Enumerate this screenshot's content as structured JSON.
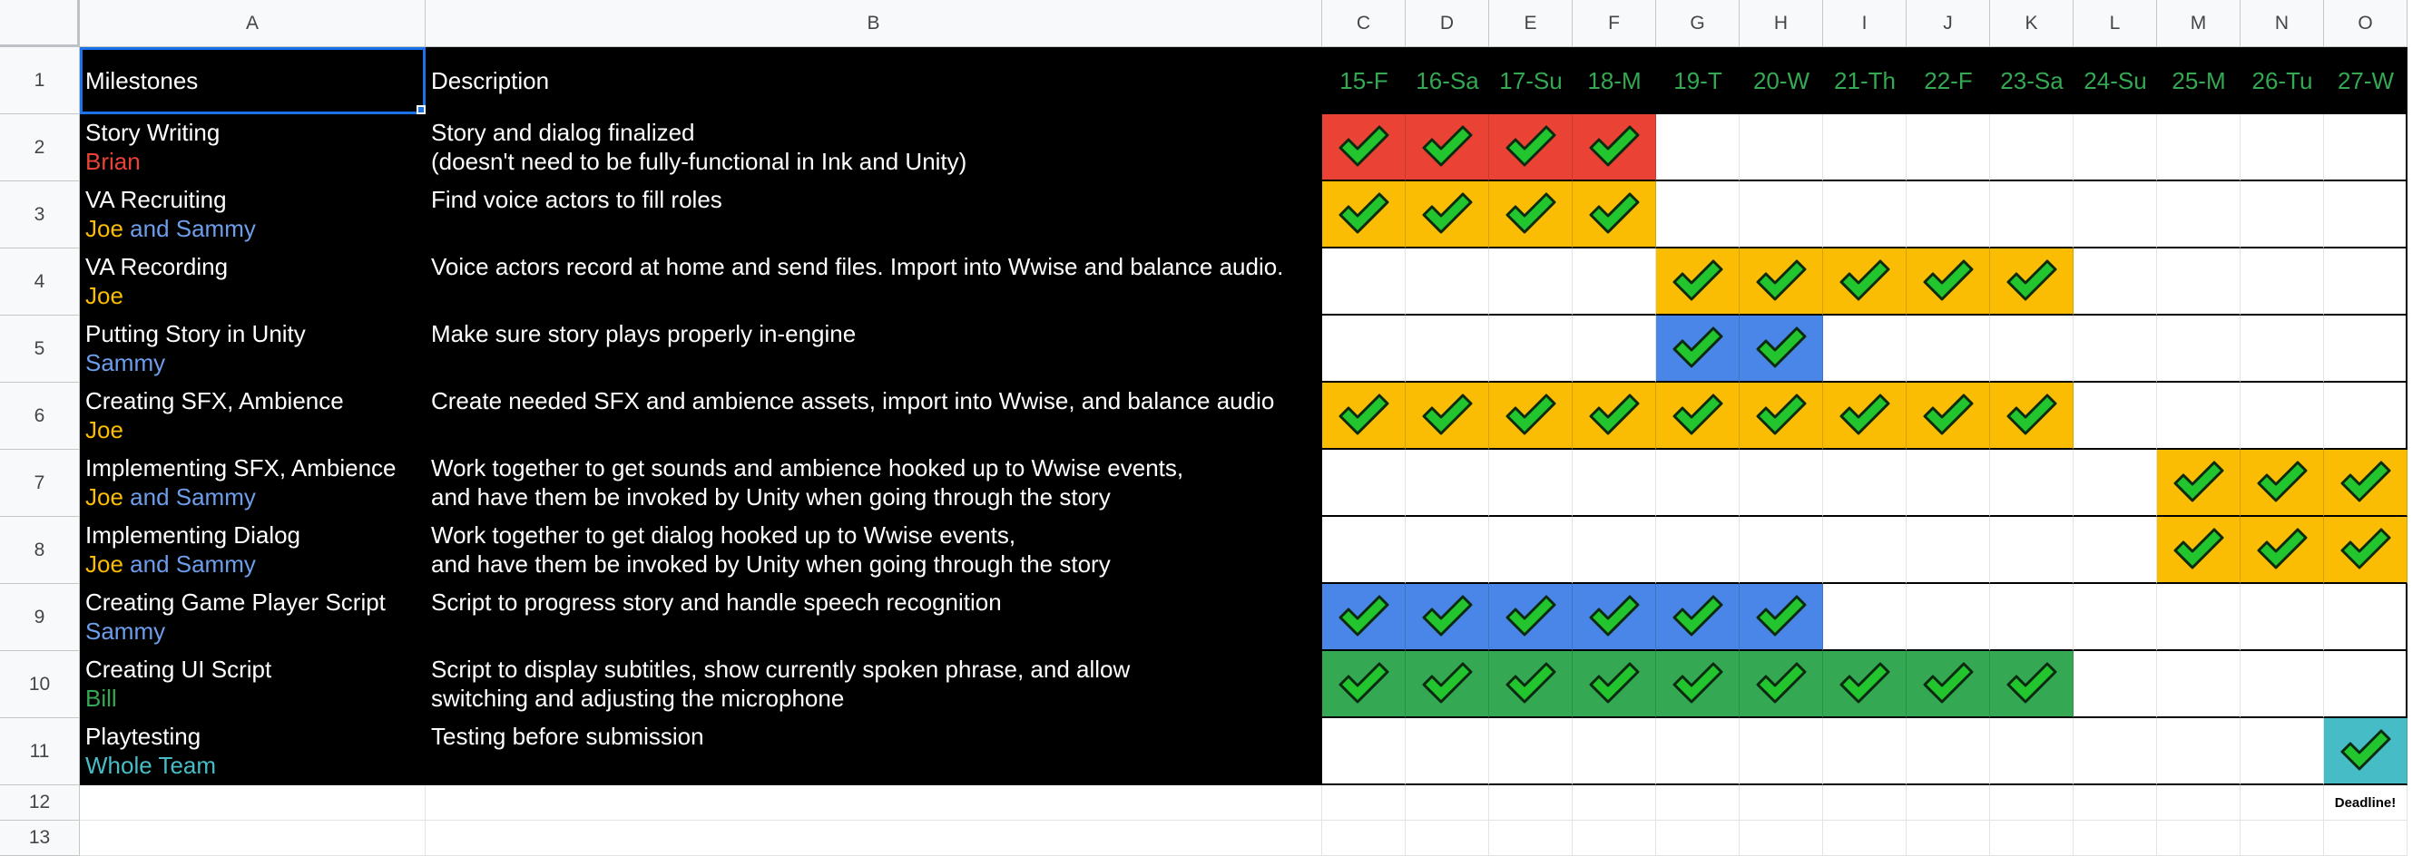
{
  "columns": [
    "A",
    "B",
    "C",
    "D",
    "E",
    "F",
    "G",
    "H",
    "I",
    "J",
    "K",
    "L",
    "M",
    "N",
    "O"
  ],
  "row_numbers": [
    "1",
    "2",
    "3",
    "4",
    "5",
    "6",
    "7",
    "8",
    "9",
    "10",
    "11",
    "12",
    "13"
  ],
  "colors": {
    "red": "#ea4335",
    "yellow": "#fbbc04",
    "blue": "#4a86e8",
    "green": "#34a853",
    "teal": "#46bdc6",
    "brian": "#ea4335",
    "joe": "#fbbc04",
    "sammy": "#6d9eeb",
    "bill": "#34a853",
    "team": "#46bdc6",
    "check_fill": "#22c52e",
    "check_stroke": "#0b2a10"
  },
  "header": {
    "milestones": "Milestones",
    "description": "Description",
    "dates": [
      "15-F",
      "16-Sa",
      "17-Su",
      "18-M",
      "19-T",
      "20-W",
      "21-Th",
      "22-F",
      "23-Sa",
      "24-Su",
      "25-M",
      "26-Tu",
      "27-W"
    ]
  },
  "rows": [
    {
      "title": "Story Writing",
      "people": [
        {
          "name": "Brian",
          "color": "brian"
        }
      ],
      "desc": [
        "Story and dialog finalized",
        "(doesn't need to be fully-functional in Ink and Unity)"
      ],
      "days": [
        0,
        1,
        2,
        3
      ],
      "fill": "red"
    },
    {
      "title": "VA Recruiting",
      "people": [
        {
          "name": "Joe",
          "color": "joe"
        },
        {
          "name": " and ",
          "color": "sammy"
        },
        {
          "name": "Sammy",
          "color": "sammy"
        }
      ],
      "desc": [
        "Find voice actors to fill roles"
      ],
      "days": [
        0,
        1,
        2,
        3
      ],
      "fill": "yellow"
    },
    {
      "title": "VA Recording",
      "people": [
        {
          "name": "Joe",
          "color": "joe"
        }
      ],
      "desc": [
        "Voice actors record at home and send files. Import into Wwise and balance audio."
      ],
      "days": [
        4,
        5,
        6,
        7,
        8
      ],
      "fill": "yellow"
    },
    {
      "title": "Putting Story in Unity",
      "people": [
        {
          "name": "Sammy",
          "color": "sammy"
        }
      ],
      "desc": [
        "Make sure story plays properly in-engine"
      ],
      "days": [
        4,
        5
      ],
      "fill": "blue"
    },
    {
      "title": "Creating SFX, Ambience",
      "people": [
        {
          "name": "Joe",
          "color": "joe"
        }
      ],
      "desc": [
        "Create needed SFX and ambience assets, import into Wwise, and balance audio"
      ],
      "days": [
        0,
        1,
        2,
        3,
        4,
        5,
        6,
        7,
        8
      ],
      "fill": "yellow"
    },
    {
      "title": "Implementing SFX, Ambience",
      "people": [
        {
          "name": "Joe",
          "color": "joe"
        },
        {
          "name": " and ",
          "color": "sammy"
        },
        {
          "name": "Sammy",
          "color": "sammy"
        }
      ],
      "desc": [
        "Work together to get sounds and ambience hooked up to Wwise events,",
        "and have them be invoked by Unity when going through the story"
      ],
      "days": [
        10,
        11,
        12
      ],
      "fill": "yellow"
    },
    {
      "title": "Implementing Dialog",
      "people": [
        {
          "name": "Joe",
          "color": "joe"
        },
        {
          "name": " and ",
          "color": "sammy"
        },
        {
          "name": "Sammy",
          "color": "sammy"
        }
      ],
      "desc": [
        "Work together to get dialog hooked up to Wwise events,",
        "and have them be invoked by Unity when going through the story"
      ],
      "days": [
        10,
        11,
        12
      ],
      "fill": "yellow"
    },
    {
      "title": "Creating Game Player Script",
      "people": [
        {
          "name": "Sammy",
          "color": "sammy"
        }
      ],
      "desc": [
        "Script to progress story and handle speech recognition"
      ],
      "days": [
        0,
        1,
        2,
        3,
        4,
        5
      ],
      "fill": "blue"
    },
    {
      "title": "Creating UI Script",
      "people": [
        {
          "name": "Bill",
          "color": "bill"
        }
      ],
      "desc": [
        "Script to display subtitles, show currently spoken phrase, and allow",
        "switching and adjusting the microphone"
      ],
      "days": [
        0,
        1,
        2,
        3,
        4,
        5,
        6,
        7,
        8
      ],
      "fill": "green"
    },
    {
      "title": "Playtesting",
      "people": [
        {
          "name": "Whole Team",
          "color": "team"
        }
      ],
      "desc": [
        "Testing before submission"
      ],
      "days": [
        12
      ],
      "fill": "teal"
    }
  ],
  "deadline_note": "Deadline!"
}
